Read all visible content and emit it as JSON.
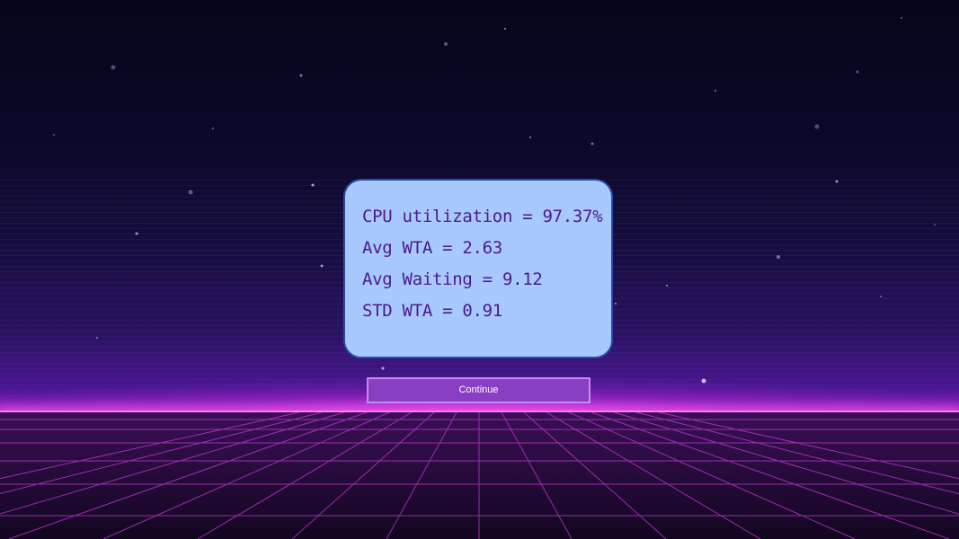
{
  "stats": {
    "cpu_utilization": "CPU utilization = 97.37%",
    "avg_wta": "Avg WTA = 2.63",
    "avg_waiting": "Avg Waiting = 9.12",
    "std_wta": "STD WTA = 0.91"
  },
  "continue_button": {
    "label": "Continue"
  },
  "colors": {
    "card_background": "#a8c9ff",
    "card_border": "#2a4aa8",
    "stat_text": "#4a1a8e",
    "button_background": "#8a3ec4",
    "horizon_glow": "#ff7bf7"
  }
}
